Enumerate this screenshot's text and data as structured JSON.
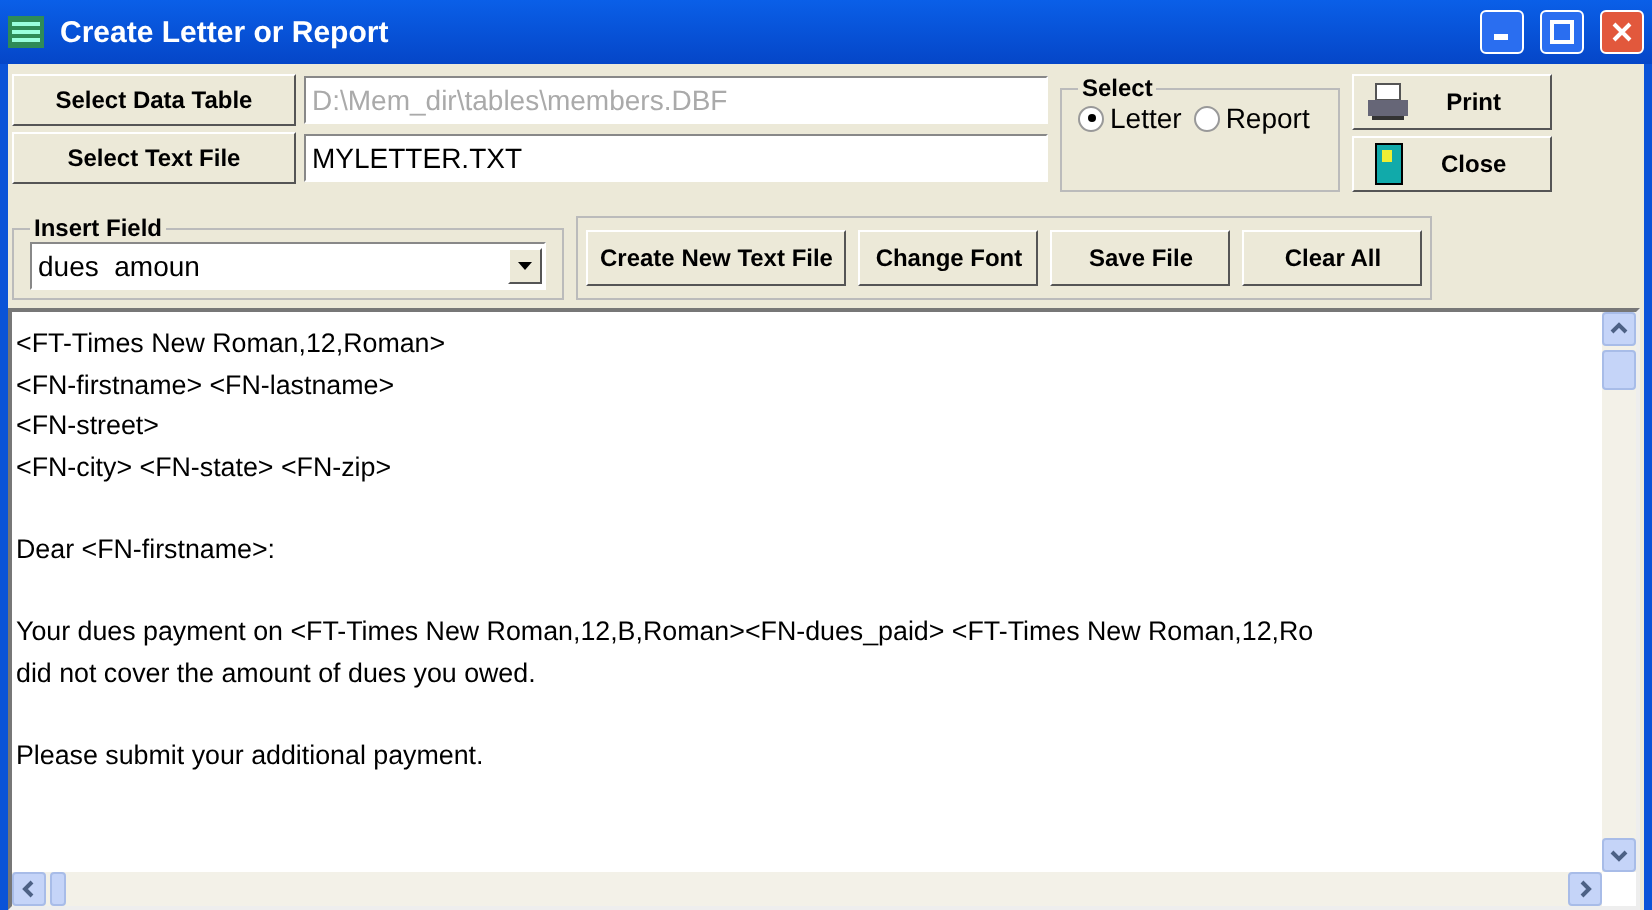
{
  "window": {
    "title": "Create Letter or Report"
  },
  "data_table": {
    "button": "Select Data Table",
    "value": "D:\\Mem_dir\\tables\\members.DBF",
    "disabled": true
  },
  "text_file": {
    "button": "Select Text File",
    "value": "MYLETTER.TXT",
    "disabled": false
  },
  "select": {
    "label": "Select",
    "options": [
      {
        "label": "Letter",
        "selected": true
      },
      {
        "label": "Report",
        "selected": false
      }
    ]
  },
  "side_buttons": [
    {
      "label": "Print",
      "kind": "print"
    },
    {
      "label": "Close",
      "kind": "close"
    }
  ],
  "insert_field": {
    "label": "Insert Field",
    "value": "dues  amoun"
  },
  "toolbar": [
    "Create New Text File",
    "Change Font",
    "Save File",
    "Clear All"
  ],
  "editor": {
    "paragraphs": [
      [
        "<FT-Times New Roman,12,Roman>",
        "<FN-firstname> <FN-lastname>",
        "<FN-street>",
        "<FN-city> <FN-state> <FN-zip>"
      ],
      [
        "Dear <FN-firstname>:"
      ],
      [
        "Your dues payment on <FT-Times New Roman,12,B,Roman><FN-dues_paid> <FT-Times New Roman,12,Ro",
        "did not cover the amount of dues you owed."
      ],
      [
        "Please submit your additional payment."
      ]
    ]
  }
}
